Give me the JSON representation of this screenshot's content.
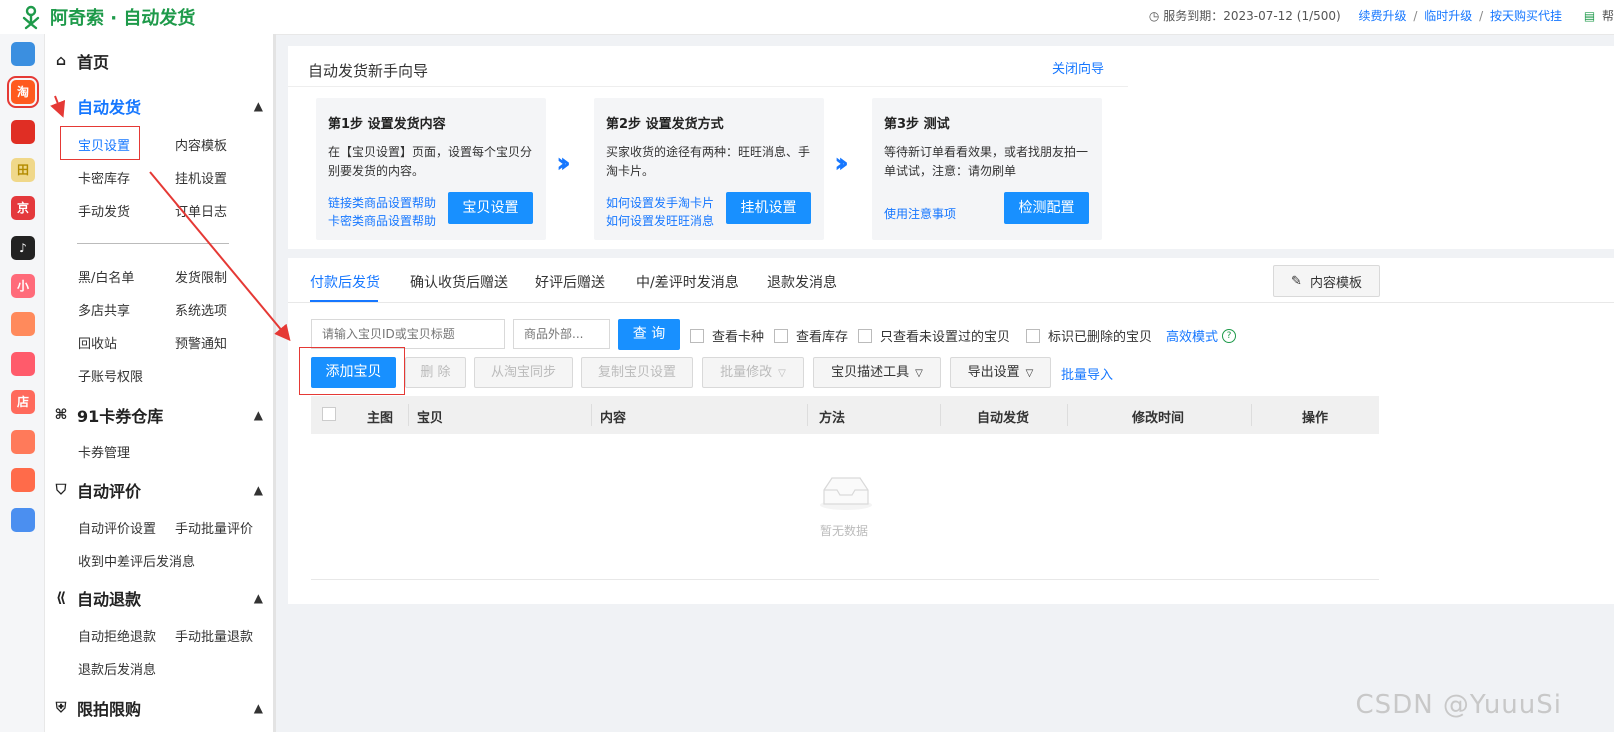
{
  "app": {
    "title": "阿奇索 · 自动发货",
    "service_label": "服务到期：2023-07-12 (1/500)",
    "links": [
      "续费升级",
      "临时升级",
      "按天购买代挂"
    ],
    "help_label": "帮"
  },
  "iconbar": {
    "items": [
      {
        "name": "grid-app-icon",
        "glyph": "",
        "color": "#3b8fe0"
      },
      {
        "name": "taobao-app-icon",
        "glyph": "淘",
        "color": "#ff5a1f"
      },
      {
        "name": "pinduoduo-app-icon",
        "glyph": "",
        "color": "#e02e24"
      },
      {
        "name": "field-app-icon",
        "glyph": "田",
        "color": "#f0d88a"
      },
      {
        "name": "jd-app-icon",
        "glyph": "京",
        "color": "#e4393c"
      },
      {
        "name": "douyin-app-icon",
        "glyph": "♪",
        "color": "#222222"
      },
      {
        "name": "xiaohongshu-app-icon",
        "glyph": "小",
        "color": "#ff6b7a"
      },
      {
        "name": "cluster-app-icon",
        "glyph": "",
        "color": "#ff8a5c"
      },
      {
        "name": "thumb-app-icon",
        "glyph": "",
        "color": "#ff5b6b"
      },
      {
        "name": "shop-app-icon",
        "glyph": "店",
        "color": "#ff6a5c"
      },
      {
        "name": "bag-app-icon",
        "glyph": "",
        "color": "#ff7a5a"
      },
      {
        "name": "store-app-icon",
        "glyph": "",
        "color": "#ff6b4a"
      },
      {
        "name": "link-app-icon",
        "glyph": "",
        "color": "#4b8ff0"
      }
    ]
  },
  "sidebar": {
    "home": "首页",
    "sections": [
      {
        "title": "自动发货",
        "items": [
          "宝贝设置",
          "内容模板",
          "卡密库存",
          "挂机设置",
          "手动发货",
          "订单日志",
          "黑/白名单",
          "发货限制",
          "多店共享",
          "系统选项",
          "回收站",
          "预警通知",
          "子账号权限"
        ]
      },
      {
        "title": "91卡券仓库",
        "items": [
          "卡券管理"
        ]
      },
      {
        "title": "自动评价",
        "items": [
          "自动评价设置",
          "手动批量评价",
          "收到中差评后发消息"
        ]
      },
      {
        "title": "自动退款",
        "items": [
          "自动拒绝退款",
          "手动批量退款",
          "退款后发消息"
        ]
      },
      {
        "title": "限拍限购",
        "items": []
      }
    ]
  },
  "wizard": {
    "title": "自动发货新手向导",
    "close": "关闭向导",
    "steps": [
      {
        "title": "第1步 设置发货内容",
        "desc": "在【宝贝设置】页面，设置每个宝贝分别要发货的内容。",
        "links": [
          "链接类商品设置帮助",
          "卡密类商品设置帮助"
        ],
        "button": "宝贝设置"
      },
      {
        "title": "第2步 设置发货方式",
        "desc": "买家收货的途径有两种：旺旺消息、手淘卡片。",
        "links": [
          "如何设置发手淘卡片",
          "如何设置发旺旺消息"
        ],
        "button": "挂机设置"
      },
      {
        "title": "第3步 测试",
        "desc": "等待新订单看看效果，或者找朋友拍一单试试，注意：请勿刷单",
        "links": [
          "使用注意事项"
        ],
        "button": "检测配置"
      }
    ]
  },
  "tabs": [
    "付款后发货",
    "确认收货后赠送",
    "好评后赠送",
    "中/差评时发消息",
    "退款发消息"
  ],
  "template_button": "内容模板",
  "search": {
    "item_placeholder": "请输入宝贝ID或宝贝标题",
    "outer_placeholder": "商品外部...",
    "query": "查 询"
  },
  "filters": [
    "查看卡种",
    "查看库存",
    "只查看未设置过的宝贝",
    "标识已删除的宝贝"
  ],
  "efficient_mode": "高效模式",
  "toolbar": {
    "add": "添加宝贝",
    "delete": "删 除",
    "sync": "从淘宝同步",
    "copy": "复制宝贝设置",
    "batch_edit": "批量修改",
    "desc_tool": "宝贝描述工具",
    "export": "导出设置",
    "batch_import": "批量导入"
  },
  "table": {
    "columns": [
      "主图",
      "宝贝",
      "内容",
      "方法",
      "自动发货",
      "修改时间",
      "操作"
    ],
    "empty": "暂无数据"
  },
  "watermark": "CSDN @YuuuSi",
  "colors": {
    "brand": "#1e9a4a",
    "primary": "#1890ff",
    "link": "#1677ff",
    "annotation": "#e53935"
  }
}
